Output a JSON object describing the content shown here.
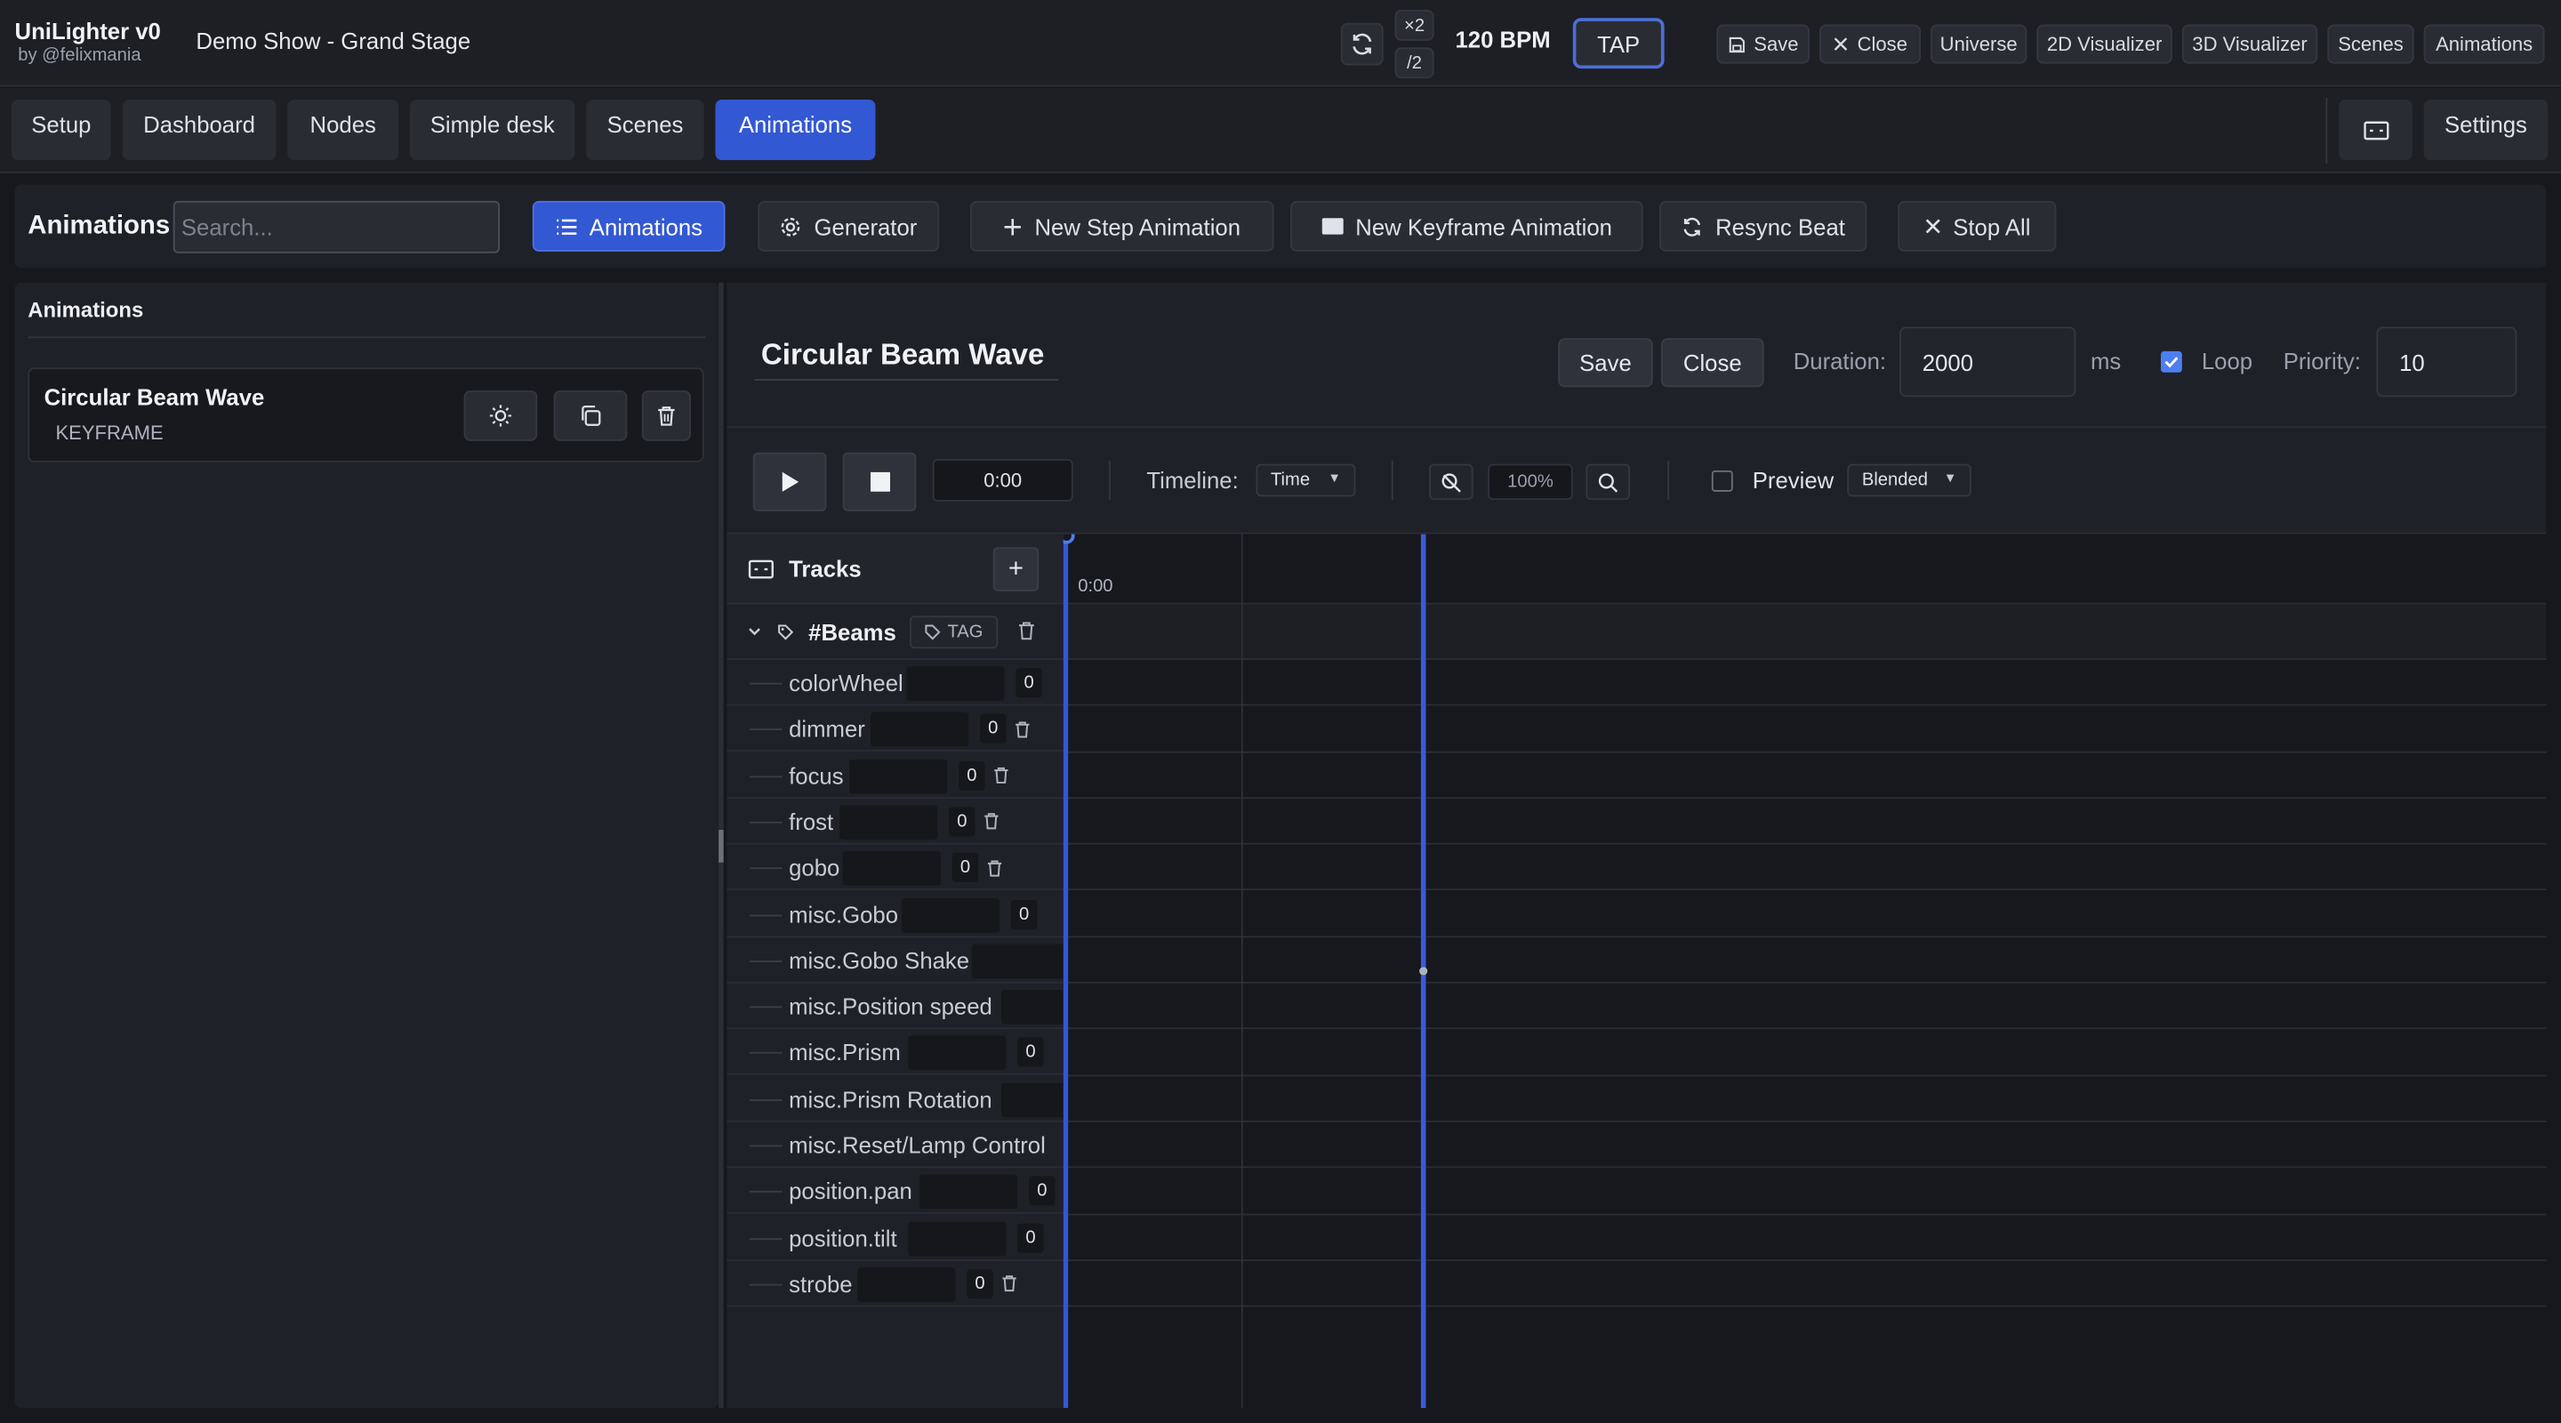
{
  "app": {
    "name": "UniLighter v0",
    "author": "by @felixmania",
    "show": "Demo Show - Grand Stage"
  },
  "header": {
    "mult_label": "×2",
    "div_label": "/2",
    "bpm": "120 BPM",
    "tap_label": "TAP",
    "buttons": [
      "Save",
      "Close",
      "Universe",
      "2D Visualizer",
      "3D Visualizer",
      "Scenes",
      "Animations"
    ]
  },
  "nav": {
    "tabs": [
      "Setup",
      "Dashboard",
      "Nodes",
      "Simple desk",
      "Scenes",
      "Animations"
    ],
    "active_tab": "Animations",
    "settings_label": "Settings"
  },
  "toolbar": {
    "title": "Animations",
    "search_placeholder": "Search...",
    "buttons": [
      "Animations",
      "Generator",
      "New Step Animation",
      "New Keyframe Animation",
      "Resync Beat",
      "Stop All"
    ]
  },
  "sidebar": {
    "title": "Animations",
    "items": [
      {
        "name": "Circular Beam Wave",
        "type": "KEYFRAME"
      }
    ]
  },
  "editor": {
    "title": "Circular Beam Wave",
    "save_label": "Save",
    "close_label": "Close",
    "duration_label": "Duration:",
    "duration_value": "2000",
    "duration_unit": "ms",
    "loop_label": "Loop",
    "loop_checked": true,
    "priority_label": "Priority:",
    "priority_value": "10",
    "time_display": "0:00",
    "timeline_label": "Timeline:",
    "timeline_mode": "Time",
    "zoom": "100%",
    "preview_label": "Preview",
    "preview_checked": false,
    "preview_mode": "Blended",
    "tracks_title": "Tracks",
    "add_label": "+",
    "group": {
      "name": "#Beams",
      "tag_label": "TAG"
    },
    "tracks": [
      {
        "name": "colorWheel",
        "value": "0"
      },
      {
        "name": "dimmer",
        "value": "0"
      },
      {
        "name": "focus",
        "value": "0"
      },
      {
        "name": "frost",
        "value": "0"
      },
      {
        "name": "gobo",
        "value": "0"
      },
      {
        "name": "misc.Gobo",
        "value": "0"
      },
      {
        "name": "misc.Gobo Shake",
        "value": ""
      },
      {
        "name": "misc.Position speed",
        "value": ""
      },
      {
        "name": "misc.Prism",
        "value": "0"
      },
      {
        "name": "misc.Prism Rotation",
        "value": ""
      },
      {
        "name": "misc.Reset/Lamp Control",
        "value": ""
      },
      {
        "name": "position.pan",
        "value": "0"
      },
      {
        "name": "position.tilt",
        "value": "0"
      },
      {
        "name": "strobe",
        "value": "0"
      }
    ],
    "timeline_tick": "0:00"
  },
  "colors": {
    "accent": "#3358d4",
    "background": "#17181d",
    "panel": "#1f2128"
  }
}
